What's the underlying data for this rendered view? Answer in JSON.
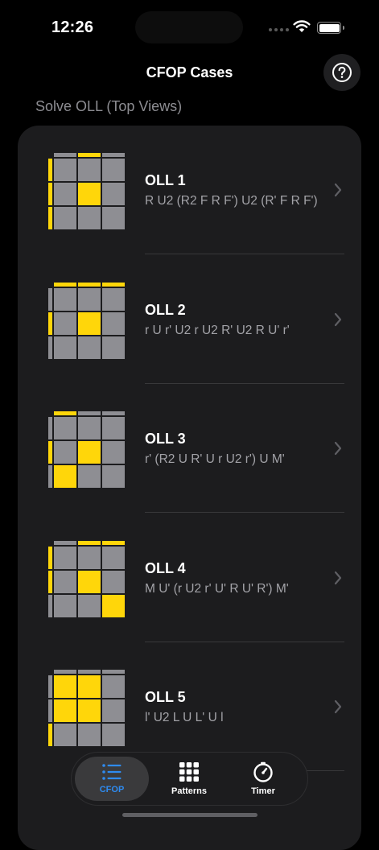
{
  "status_bar": {
    "time": "12:26",
    "icons": [
      "signal-dots-icon",
      "wifi-icon",
      "battery-icon"
    ]
  },
  "nav": {
    "title": "CFOP Cases",
    "help_icon": "question-mark-circle-icon"
  },
  "section": {
    "header": "Solve OLL (Top Views)"
  },
  "colors": {
    "yellow": "#ffd60a",
    "gray": "#8e8e93",
    "accent": "#2e8bf0",
    "card": "#1c1c1e"
  },
  "cases": [
    {
      "name": "OLL 1",
      "alg": "R U2 (R2 F R F') U2 (R' F R F')",
      "grid": [
        "GGG",
        "GYG",
        "GGG"
      ],
      "edges": {
        "top": "GYG",
        "bottom": "GYG",
        "left": "YYY",
        "right": "YYY"
      }
    },
    {
      "name": "OLL 2",
      "alg": "r U r' U2 r U2 R' U2 R U' r'",
      "grid": [
        "GGG",
        "GYG",
        "GGG"
      ],
      "edges": {
        "top": "YYY",
        "bottom": "GYG",
        "left": "GYG",
        "right": "YYY"
      }
    },
    {
      "name": "OLL 3",
      "alg": "r' (R2 U R' U r U2 r') U M'",
      "grid": [
        "GGG",
        "GYG",
        "YGG"
      ],
      "edges": {
        "top": "YGG",
        "bottom": "GYG",
        "left": "GYG",
        "right": "GGY"
      }
    },
    {
      "name": "OLL 4",
      "alg": "M U' (r U2 r' U' R U' R') M'",
      "grid": [
        "GGG",
        "GYG",
        "GGY"
      ],
      "edges": {
        "top": "GYY",
        "bottom": "GYG",
        "left": "YYG",
        "right": "GYG"
      }
    },
    {
      "name": "OLL 5",
      "alg": "l' U2 L U L' U l",
      "grid": [
        "YYG",
        "YYG",
        "GGG"
      ],
      "edges": {
        "top": "GGG",
        "bottom": "GYY",
        "left": "GGY",
        "right": "YYG"
      }
    }
  ],
  "tabs": [
    {
      "label": "CFOP",
      "icon": "list-icon",
      "active": true
    },
    {
      "label": "Patterns",
      "icon": "grid-icon",
      "active": false
    },
    {
      "label": "Timer",
      "icon": "timer-icon",
      "active": false
    }
  ]
}
